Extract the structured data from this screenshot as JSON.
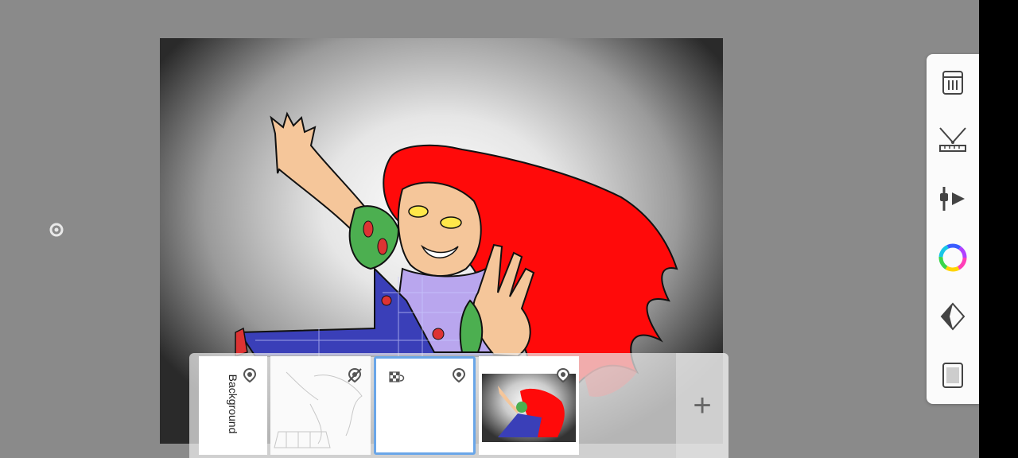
{
  "canvas": {
    "artwork": "canvas-illustration"
  },
  "toolbar": {
    "tools": [
      {
        "name": "layers-tool",
        "icon": "layers-grid-icon"
      },
      {
        "name": "ruler-tool",
        "icon": "compass-ruler-icon"
      },
      {
        "name": "adjustments-tool",
        "icon": "slider-adjust-icon"
      },
      {
        "name": "color-tool",
        "icon": "color-wheel-icon"
      },
      {
        "name": "fill-tool",
        "icon": "diamond-fill-icon"
      },
      {
        "name": "canvas-tool",
        "icon": "canvas-frame-icon"
      }
    ],
    "color_wheel_accent": "#ff3fb8"
  },
  "layers": {
    "items": [
      {
        "label": "Background",
        "visible": true
      },
      {
        "label": "",
        "visible": false
      },
      {
        "label": "",
        "visible": true,
        "selected": true
      },
      {
        "label": "",
        "visible": true
      }
    ],
    "add_label": "+"
  },
  "colors": {
    "hair": "#ff0a0a",
    "skin": "#f5c69a",
    "overalls": "#3a3fb8",
    "shirt": "#b9a6ee",
    "sleeve": "#4caf50",
    "selected_border": "#6aa6e8"
  }
}
